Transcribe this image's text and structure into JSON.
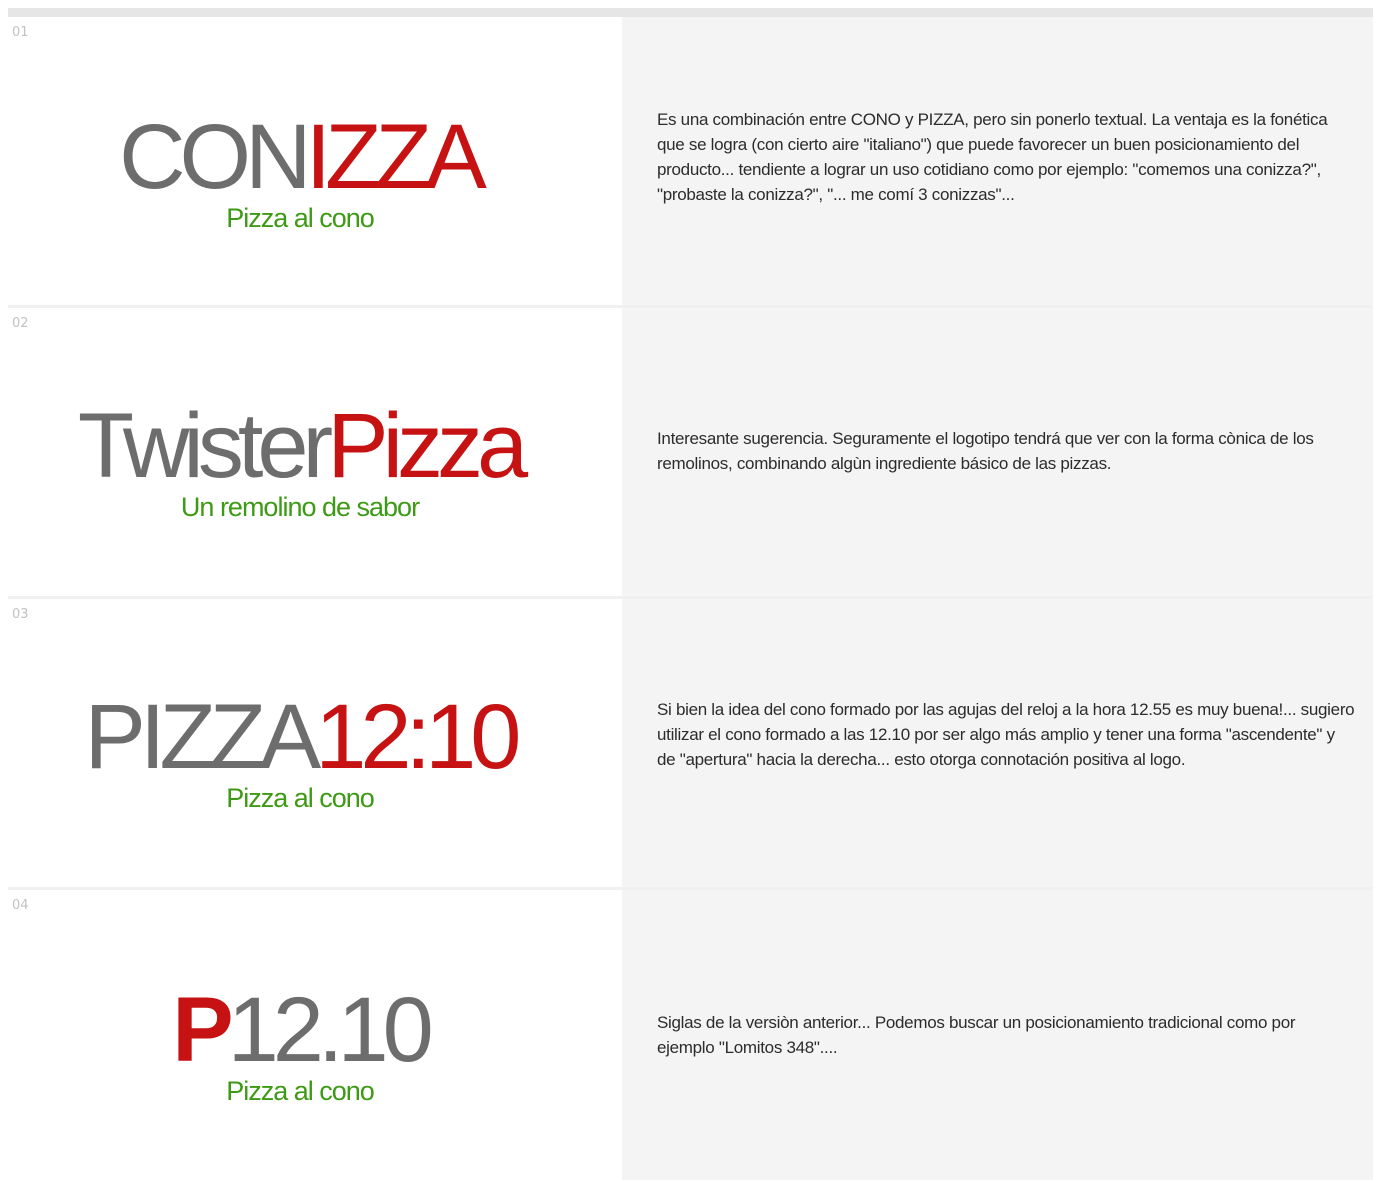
{
  "entries": [
    {
      "number": "01",
      "logo": {
        "part1": "CON",
        "part2": "IZZA",
        "tagline": "Pizza al cono"
      },
      "description": "Es una combinación entre CONO y PIZZA, pero sin ponerlo textual. La ventaja es la fonética que se logra (con cierto aire \"italiano\") que puede favorecer un buen posicionamiento del producto... tendiente a lograr un uso cotidiano como por ejemplo: \"comemos una conizza?\", \"probaste la conizza?\", \"... me comí 3 conizzas\"..."
    },
    {
      "number": "02",
      "logo": {
        "part1": "Twister",
        "part2": "Pizza",
        "tagline": "Un remolino de sabor"
      },
      "description": "Interesante sugerencia. Seguramente el logotipo tendrá que ver con la forma cònica de los remolinos, combinando algùn ingrediente básico de las pizzas."
    },
    {
      "number": "03",
      "logo": {
        "part1": "PIZZA",
        "part2": "12:10",
        "tagline": "Pizza al cono"
      },
      "description": "Si bien la idea del cono formado por las agujas del reloj a la hora 12.55 es muy buena!... sugiero utilizar el cono formado a las 12.10 por ser algo más amplio y tener una forma \"ascendente\" y de \"apertura\" hacia la derecha... esto otorga connotación positiva al logo."
    },
    {
      "number": "04",
      "logo": {
        "part1": "P",
        "part2": "12.10",
        "tagline": "Pizza al cono"
      },
      "description": "Siglas de la versiòn anterior... Podemos buscar un posicionamiento tradicional como por ejemplo \"Lomitos 348\"...."
    }
  ],
  "colors": {
    "gray_word": "#6d6d6d",
    "red_word": "#c61212",
    "green_tagline": "#3d9a14",
    "desc_panel": "#f4f4f4"
  }
}
